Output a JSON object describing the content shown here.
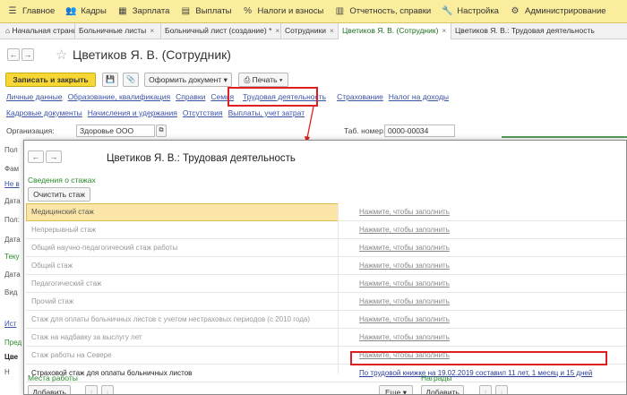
{
  "topbar": {
    "items": [
      {
        "icon": "menu-icon",
        "glyph": "☰",
        "label": "Главное"
      },
      {
        "icon": "people-icon",
        "glyph": "👥",
        "label": "Кадры"
      },
      {
        "icon": "calculator-icon",
        "glyph": "▦",
        "label": "Зарплата"
      },
      {
        "icon": "payments-icon",
        "glyph": "▤",
        "label": "Выплаты"
      },
      {
        "icon": "percent-icon",
        "glyph": "%",
        "label": "Налоги и взносы"
      },
      {
        "icon": "report-icon",
        "glyph": "▥",
        "label": "Отчетность, справки"
      },
      {
        "icon": "wrench-icon",
        "glyph": "🔧",
        "label": "Настройка"
      },
      {
        "icon": "gear-icon",
        "glyph": "⚙",
        "label": "Администрирование"
      }
    ]
  },
  "tabs": [
    {
      "label": "Начальная страница",
      "close": ""
    },
    {
      "label": "Больничные листы",
      "close": "×"
    },
    {
      "label": "Больничный лист (создание) *",
      "close": "×"
    },
    {
      "label": "Сотрудники",
      "close": "×"
    },
    {
      "label": "Цветиков Я. В. (Сотрудник)",
      "close": "×"
    },
    {
      "label": "Цветиков Я. В.: Трудовая деятельность",
      "close": ""
    }
  ],
  "nav": {
    "back": "←",
    "forward": "→",
    "star": "☆"
  },
  "page": {
    "title": "Цветиков Я. В. (Сотрудник)"
  },
  "toolbar": {
    "save_close": "Записать и закрыть",
    "save_icon": "💾",
    "attach_icon": "📎",
    "create_doc": "Оформить документ",
    "print": "Печать"
  },
  "links_row1": [
    "Личные данные",
    "Образование, квалификация",
    "Справки",
    "Семья",
    "Трудовая деятельность",
    "Страхование",
    "Налог на доходы"
  ],
  "links_row2": [
    "Кадровые документы",
    "Начисления и удержания",
    "Отсутствия",
    "Выплаты, учет затрат"
  ],
  "org": {
    "label": "Организация:",
    "value": "Здоровье ООО",
    "tab_label": "Таб. номер:",
    "tab_value": "0000-00034"
  },
  "sidebar": [
    "Пол",
    "Фам",
    "Не в",
    "Дата",
    "Пол:",
    "Дата",
    "Теку",
    "Дата",
    "Вид",
    "Ист",
    "Пред",
    "Цве",
    "Н"
  ],
  "modal": {
    "back": "←",
    "forward": "→",
    "title": "Цветиков Я. В.: Трудовая деятельность",
    "section": "Сведения о стажах",
    "clear_button": "Очистить стаж",
    "rows": [
      {
        "name": "Медицинский стаж",
        "value": "Нажмите, чтобы заполнить"
      },
      {
        "name": "Непрерывный стаж",
        "value": "Нажмите, чтобы заполнить"
      },
      {
        "name": "Общий научно-педагогический стаж работы",
        "value": "Нажмите, чтобы заполнить"
      },
      {
        "name": "Общий стаж",
        "value": "Нажмите, чтобы заполнить"
      },
      {
        "name": "Педагогический стаж",
        "value": "Нажмите, чтобы заполнить"
      },
      {
        "name": "Прочий стаж",
        "value": "Нажмите, чтобы заполнить"
      },
      {
        "name": "Стаж для оплаты больничных листов с учетом нестраховых периодов (с 2010 года)",
        "value": "Нажмите, чтобы заполнить"
      },
      {
        "name": "Стаж на надбавку за выслугу лет",
        "value": "Нажмите, чтобы заполнить"
      },
      {
        "name": "Стаж работы на Севере",
        "value": "Нажмите, чтобы заполнить"
      },
      {
        "name": "Страховой стаж для оплаты больничных листов",
        "value": "По трудовой книжке на 19.02.2019 составил 11 лет, 1 месяц и 15 дней"
      }
    ],
    "places_title": "Места работы",
    "places_add": "Добавить",
    "more": "Еще",
    "awards_title": "Награды",
    "awards_add": "Добавить"
  },
  "colors": {
    "accent": "#f6d733",
    "highlight": "#e02020",
    "link": "#3a53a6",
    "green": "#2a8a2a"
  }
}
